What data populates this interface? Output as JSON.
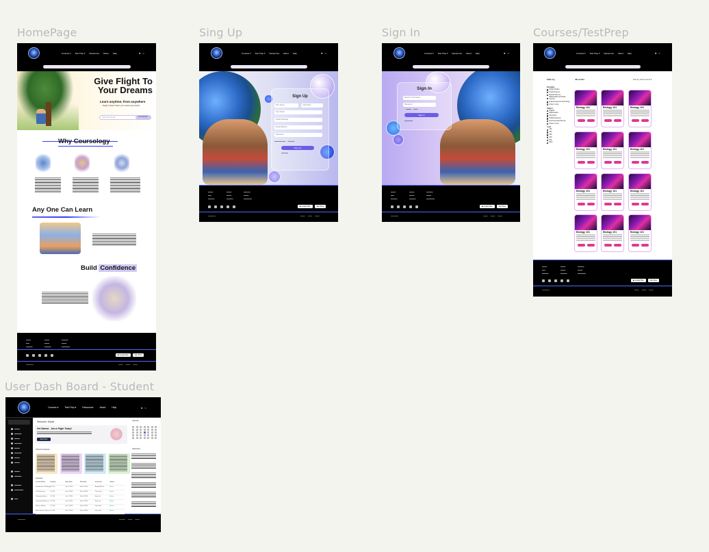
{
  "frames": {
    "homepage": "HomePage",
    "signup": "Sing Up",
    "signin": "Sign In",
    "courses": "Courses/TestPrep",
    "dashboard": "User Dash Board - Student"
  },
  "nav": {
    "courses": "Courses ▾",
    "testprep": "Test Prep ▾",
    "resources": "Resources",
    "about": "About",
    "help": "Help"
  },
  "home": {
    "hero_title_1": "Give Flight To",
    "hero_title_2": "Your Dreams",
    "hero_sub": "Learn anytime, from anywhere",
    "hero_sub2": "Ready to learn? Enter your email to get started",
    "email_placeholder": "Enter your Email",
    "get_started": "Get Started",
    "why_title": "Why Coursology",
    "any_one_title": "Any One Can Learn",
    "build": "Build",
    "confidence": "Confidence"
  },
  "signup": {
    "title": "Sign Up",
    "first_name": "First Name",
    "last_name": "Last Name",
    "user_name": "User Name",
    "grade": "Grade Standing",
    "email": "Email Address",
    "password": "Password",
    "button": "Sign Up"
  },
  "signin": {
    "title": "Sign In",
    "email": "Email or User Name",
    "password": "Password",
    "button": "Sign In"
  },
  "courses": {
    "filter_by": "Filter by",
    "results": "48 results",
    "sort": "Sort by: Most recent ▾",
    "groups": [
      {
        "label": "Discipline",
        "items": [
          "Social Studies",
          "Social Science",
          "Natural Science",
          "Mathematics and Data Science",
          "Engineering and Technology",
          "Show 4 more"
        ]
      },
      {
        "label": "Subject",
        "items": [
          "English",
          "Mathematics",
          "Chemistry",
          "Political Science",
          "Environmental Science",
          "Show 4 more"
        ]
      },
      {
        "label": "Level",
        "items": [
          "100",
          "200",
          "300",
          "400",
          "500",
          "Beta"
        ]
      }
    ],
    "card_title": "Biology 101"
  },
  "dashboard": {
    "welcome": "Welcome, Maria!",
    "headline": "Get Started - Job or Flight Today?",
    "cta": "Start Here",
    "section_courses": "Current Courses",
    "section_calendar": "Calendar",
    "section_lessons": "Lessons",
    "section_upcoming": "Upcoming",
    "table_headers": [
      "Lesson Name",
      "Number",
      "Start Date",
      "End Date",
      "Instructor",
      "Status"
    ],
    "rows": [
      [
        "Introduction to Biology",
        "UI 101",
        "Jan 2 2024",
        "Feb 4 2024",
        "Brody Walton",
        "Active"
      ],
      [
        "Cell Structures",
        "UI 102",
        "Jan 2 2024",
        "Feb 4 2024",
        "Tina Scott",
        "Active"
      ],
      [
        "Chemistry Basics",
        "UI 103",
        "Jan 2 2024",
        "Feb 4 2024",
        "Sam Lee",
        "Active"
      ],
      [
        "Chemistry Elements",
        "UI 104",
        "Jan 2 2024",
        "Feb 4 2024",
        "Sam Lee",
        "Active"
      ],
      [
        "Physics Motion",
        "UI 105",
        "Jan 2 2024",
        "Feb 4 2024",
        "Gina Hart",
        "Active"
      ],
      [
        "Earth Science Basics",
        "UI 106",
        "Jan 2 2024",
        "Feb 4 2024",
        "Carl Ortiz",
        "Active"
      ]
    ]
  },
  "colors": {
    "accent": "#6c5de6",
    "pink": "#e0388f",
    "nav": "#000000",
    "footer_line": "#4d6bff"
  }
}
